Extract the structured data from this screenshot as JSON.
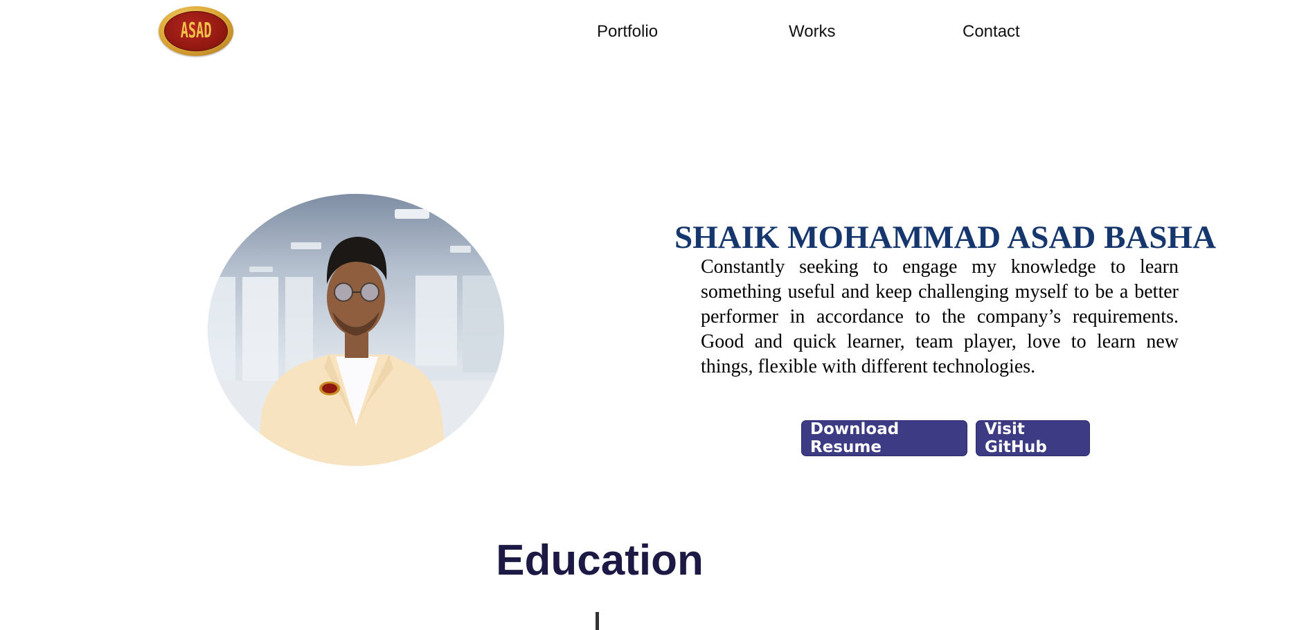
{
  "header": {
    "logo_text": "ASAD",
    "nav": {
      "portfolio": "Portfolio",
      "works": "Works",
      "contact": "Contact"
    }
  },
  "hero": {
    "name": "SHAIK MOHAMMAD ASAD BASHA",
    "bio": "Constantly seeking to engage my knowledge to learn something useful and keep challenging myself to be a better performer in accordance to the company’s requirements. Good and quick learner, team player, love to learn new things, flexible with different technologies.",
    "buttons": {
      "resume": "Download Resume",
      "github": "Visit GitHub"
    }
  },
  "education": {
    "title": "Education"
  },
  "colors": {
    "name": "#16366e",
    "button_bg": "#3d3b83",
    "section_title": "#1c1a45"
  },
  "icons": {
    "logo": "asad-oval-emblem",
    "profile": "profile-photo"
  }
}
